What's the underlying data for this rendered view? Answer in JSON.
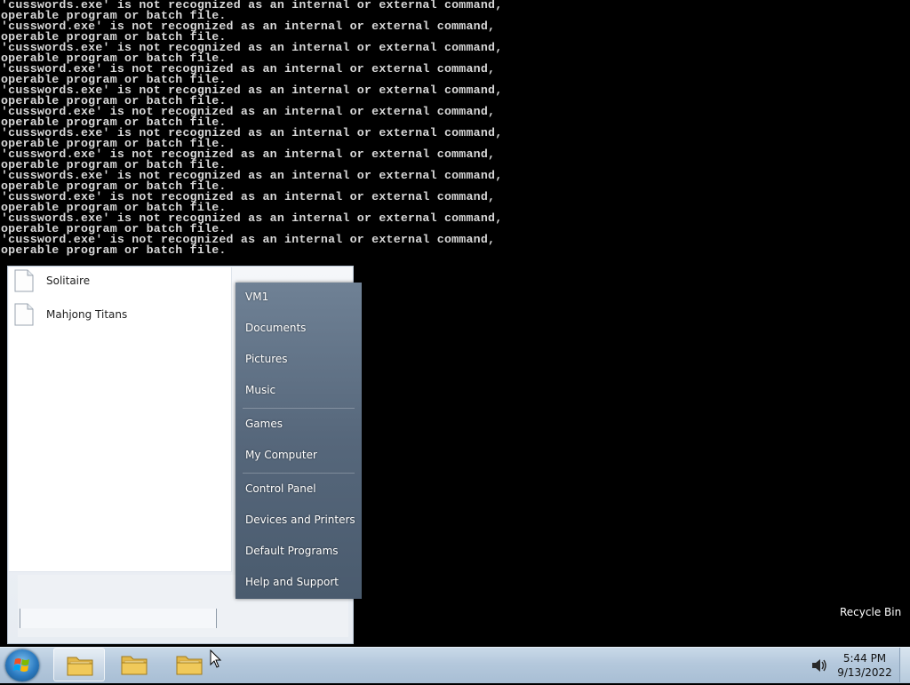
{
  "console": {
    "lines": [
      "'cusswords.exe' is not recognized as an internal or external command,",
      "operable program or batch file.",
      "'cussword.exe' is not recognized as an internal or external command,",
      "operable program or batch file.",
      "'cusswords.exe' is not recognized as an internal or external command,",
      "operable program or batch file.",
      "'cussword.exe' is not recognized as an internal or external command,",
      "operable program or batch file.",
      "'cusswords.exe' is not recognized as an internal or external command,",
      "operable program or batch file.",
      "'cussword.exe' is not recognized as an internal or external command,",
      "operable program or batch file.",
      "'cusswords.exe' is not recognized as an internal or external command,",
      "operable program or batch file.",
      "'cussword.exe' is not recognized as an internal or external command,",
      "operable program or batch file.",
      "'cusswords.exe' is not recognized as an internal or external command,",
      "operable program or batch file.",
      "'cussword.exe' is not recognized as an internal or external command,",
      "operable program or batch file.",
      "'cusswords.exe' is not recognized as an internal or external command,",
      "operable program or batch file.",
      "'cussword.exe' is not recognized as an internal or external command,",
      "operable program or batch file."
    ]
  },
  "desktop": {
    "recycle_bin_label": "Recycle Bin"
  },
  "start_menu": {
    "programs": [
      {
        "label": "Solitaire",
        "icon": "file-icon"
      },
      {
        "label": "Mahjong Titans",
        "icon": "file-icon"
      }
    ],
    "places": [
      {
        "label": "VM1"
      },
      {
        "label": "Documents"
      },
      {
        "label": "Pictures"
      },
      {
        "label": "Music"
      },
      {
        "label": "Games"
      },
      {
        "label": "My Computer"
      },
      {
        "label": "Control Panel"
      },
      {
        "label": "Devices and Printers"
      },
      {
        "label": "Default Programs"
      },
      {
        "label": "Help and Support"
      }
    ]
  },
  "taskbar": {
    "start_icon": "windows-orb-icon",
    "buttons": [
      {
        "icon": "folder-icon",
        "active": true
      },
      {
        "icon": "folder-icon",
        "active": false
      },
      {
        "icon": "folder-icon",
        "active": false
      }
    ],
    "tray": {
      "volume_icon": "speaker-icon",
      "time": "5:44 PM",
      "date": "9/13/2022"
    }
  },
  "colors": {
    "console_bg": "#000000",
    "console_text": "#d8d8d8",
    "places_pane": "#56677b",
    "taskbar": "#b4c8dc"
  }
}
